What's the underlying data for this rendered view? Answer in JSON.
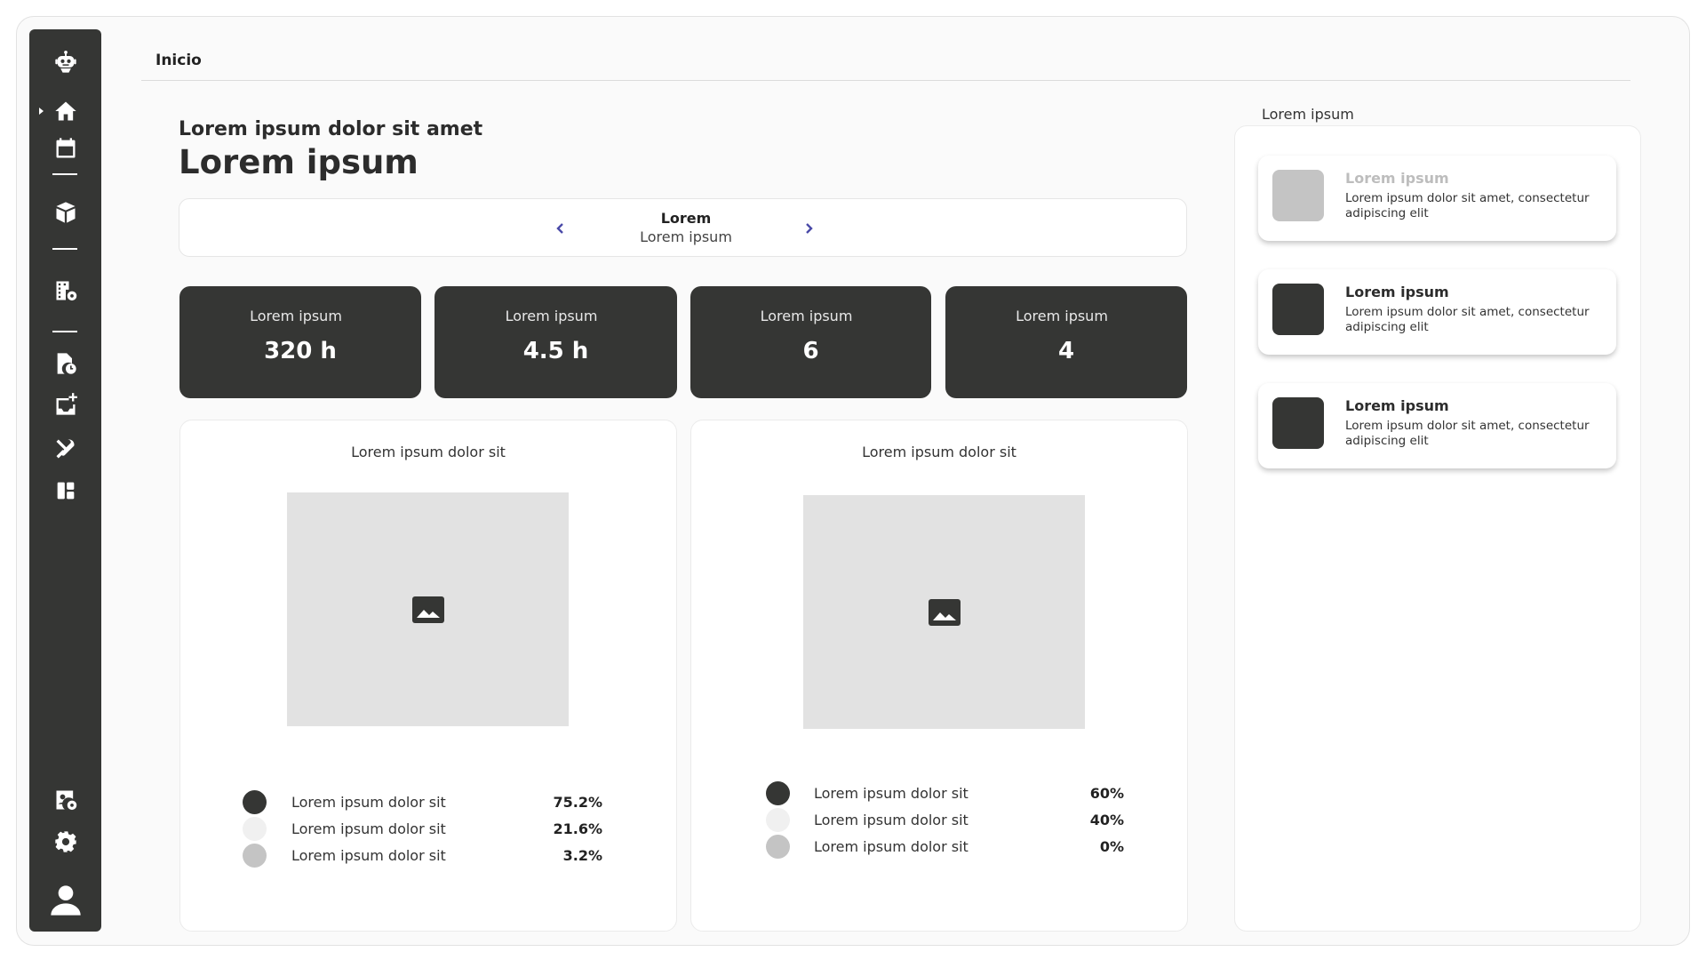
{
  "breadcrumb": "Inicio",
  "header": {
    "subtitle": "Lorem ipsum dolor sit amet",
    "title": "Lorem ipsum"
  },
  "navigator": {
    "line1": "Lorem",
    "line2": "Lorem ipsum"
  },
  "stats": [
    {
      "label": "Lorem ipsum",
      "value": "320 h"
    },
    {
      "label": "Lorem ipsum",
      "value": "4.5 h"
    },
    {
      "label": "Lorem ipsum",
      "value": "6"
    },
    {
      "label": "Lorem ipsum",
      "value": "4"
    }
  ],
  "charts": [
    {
      "title": "Lorem ipsum dolor sit",
      "legend": [
        {
          "label": "Lorem ipsum dolor sit",
          "value": "75.2%",
          "color": "#353634"
        },
        {
          "label": "Lorem ipsum dolor sit",
          "value": "21.6%",
          "color": "#f0f0f0"
        },
        {
          "label": "Lorem ipsum dolor sit",
          "value": "3.2%",
          "color": "#c4c4c4"
        }
      ]
    },
    {
      "title": "Lorem ipsum dolor sit",
      "legend": [
        {
          "label": "Lorem ipsum dolor sit",
          "value": "60%",
          "color": "#353634"
        },
        {
          "label": "Lorem ipsum dolor sit",
          "value": "40%",
          "color": "#f0f0f0"
        },
        {
          "label": "Lorem ipsum dolor sit",
          "value": "0%",
          "color": "#c4c4c4"
        }
      ]
    }
  ],
  "panel": {
    "title": "Lorem ipsum",
    "items": [
      {
        "title": "Lorem ipsum",
        "text": "Lorem ipsum dolor sit amet, consectetur adipiscing elit",
        "thumb_color": "#c4c4c4",
        "title_color": "#bdbdbd"
      },
      {
        "title": "Lorem ipsum",
        "text": "Lorem ipsum dolor sit amet, consectetur adipiscing elit",
        "thumb_color": "#353634",
        "title_color": "#2c2c2c"
      },
      {
        "title": "Lorem ipsum",
        "text": "Lorem ipsum dolor sit amet, consectetur adipiscing elit",
        "thumb_color": "#353634",
        "title_color": "#2c2c2c"
      }
    ]
  },
  "sidebar": {
    "icons": [
      "robot-logo-icon",
      "home-icon",
      "calendar-icon",
      "box-icon",
      "building-settings-icon",
      "document-clock-icon",
      "inbox-add-icon",
      "tools-icon",
      "dashboard-icon",
      "user-settings-icon",
      "gear-icon",
      "user-icon"
    ],
    "active": "home-icon"
  },
  "colors": {
    "sidebar": "#353634",
    "accent": "#4a4aa8",
    "placeholder": "#e2e2e2"
  }
}
